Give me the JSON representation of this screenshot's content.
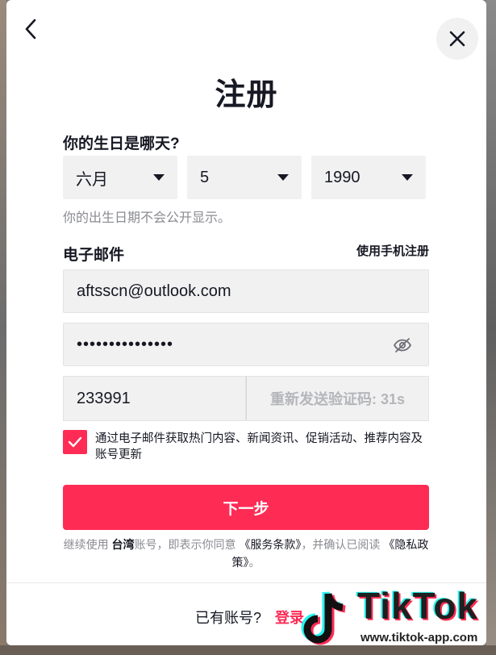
{
  "header": {
    "title": "注册"
  },
  "birthday": {
    "label": "你的生日是哪天?",
    "month": "六月",
    "day": "5",
    "year": "1990",
    "hint": "你的出生日期不会公开显示。"
  },
  "email_section": {
    "label": "电子邮件",
    "switch_link": "使用手机注册",
    "email_value": "aftsscn@outlook.com",
    "password_masked": "•••••••••••••••",
    "code_value": "233991",
    "resend_label": "重新发送验证码: 31s"
  },
  "consent": {
    "checked": true,
    "text": "通过电子邮件获取热门内容、新闻资讯、促销活动、推荐内容及账号更新"
  },
  "next_button": {
    "label": "下一步"
  },
  "legal": {
    "prefix": "继续使用",
    "region": "台湾",
    "middle": "账号，即表示你同意",
    "terms": "《服务条款》",
    "after_terms": "，并确认已阅读",
    "privacy": "《隐私政策》",
    "suffix": "。"
  },
  "footer": {
    "prompt": "已有账号?",
    "login": "登录"
  },
  "watermark": {
    "brand": "TikTok",
    "url": "www.tiktok-app.com"
  },
  "colors": {
    "accent": "#fe2c55",
    "field_bg": "#f1f1f2",
    "text": "#161823",
    "muted": "#8a8b91"
  }
}
